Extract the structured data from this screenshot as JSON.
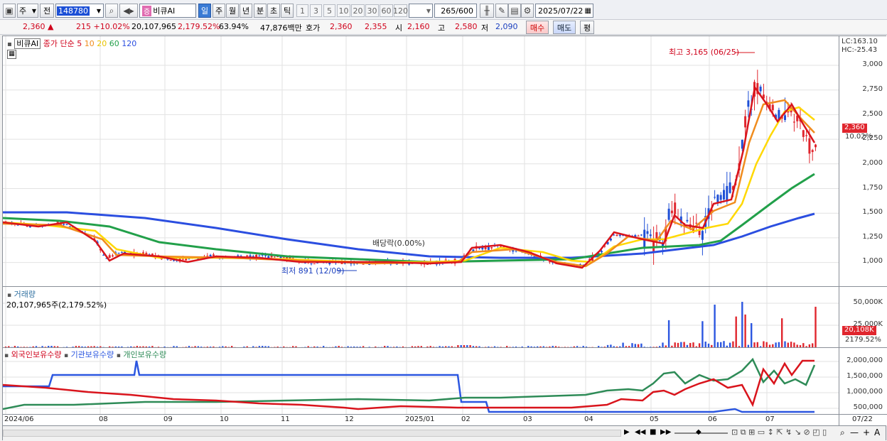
{
  "toolbar": {
    "market_select": "주",
    "prev_button": "전",
    "code_value": "148780",
    "stock_name": "비큐AI",
    "stock_badge": "증",
    "periods": [
      "일",
      "주",
      "월",
      "년",
      "분",
      "초",
      "틱"
    ],
    "active_period": "일",
    "intervals": [
      "1",
      "3",
      "5",
      "10",
      "20",
      "30",
      "60",
      "120"
    ],
    "count_value": "265",
    "count_total": "/600",
    "date_value": "2025/07/22"
  },
  "quote": {
    "price": "2,360",
    "change": "215",
    "change_pct": "+10.02%",
    "volume": "20,107,965",
    "volume_pct": "2,179.52%",
    "ratio": "63.94%",
    "amount": "47,876백만",
    "bid_label": "호가",
    "bid1": "2,360",
    "bid2": "2,355",
    "open_label": "시",
    "open": "2,160",
    "high_label": "고",
    "high": "2,580",
    "low_label": "저",
    "low": "2,090",
    "buy_button": "매수",
    "sell_button": "매도",
    "avg_button": "평"
  },
  "price_pane": {
    "legend_name": "비큐AI",
    "legend_price": "종가",
    "legend_method": "단순",
    "ma_periods": [
      "5",
      "10",
      "20",
      "60",
      "120"
    ],
    "ma_colors": [
      "#d9141c",
      "#f08c1e",
      "#ffd800",
      "#22a04a",
      "#2b4ee0"
    ],
    "lc_label": "LC:163.10",
    "hc_label": "HC:-25.43",
    "y_ticks": [
      "3,000",
      "2,750",
      "2,500",
      "2,250",
      "2,000",
      "1,750",
      "1,500",
      "1,250",
      "1,000"
    ],
    "y_values": [
      3000,
      2750,
      2500,
      2250,
      2000,
      1750,
      1500,
      1250,
      1000
    ],
    "price_tag": "2,360",
    "pct_tag": "10.02%",
    "high_note": "최고 3,165 (06/25)",
    "low_note": "최저 891 (12/09)",
    "dividend_note": "배당락(0.00%)"
  },
  "volume_pane": {
    "title": "거래량",
    "summary": "20,107,965주(2,179.52%)",
    "y_ticks": [
      "50,000K",
      "25,000K"
    ],
    "tag": "20,108K",
    "pct": "2179.52%"
  },
  "holding_pane": {
    "series": [
      {
        "name": "외국인보유수량",
        "color": "#d9141c"
      },
      {
        "name": "기관보유수량",
        "color": "#2b56e0"
      },
      {
        "name": "개인보유수량",
        "color": "#2e8b57"
      }
    ],
    "y_ticks": [
      "2,000,000",
      "1,500,000",
      "1,000,000",
      "500,000"
    ]
  },
  "x_axis": {
    "labels": [
      "2024/06",
      "08",
      "09",
      "10",
      "11",
      "12",
      "2025/01",
      "02",
      "03",
      "04",
      "05",
      "06",
      "07"
    ],
    "end_label": "07/22"
  }
}
